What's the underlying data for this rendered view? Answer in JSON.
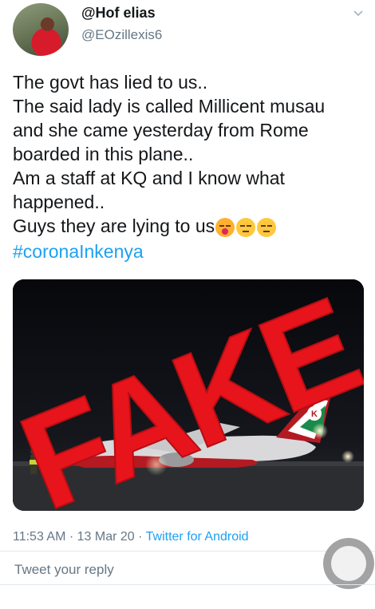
{
  "header": {
    "display_name": "@Hof elias",
    "handle": "@EOzillexis6"
  },
  "tweet": {
    "lines": [
      "The govt has lied to us..",
      "The said lady is called Millicent musau",
      "and she came yesterday from Rome",
      "boarded in this plane..",
      "Am a staff at KQ and I know what",
      "happened..",
      "Guys they are lying to us"
    ],
    "emojis": [
      "crying-face-icon",
      "unamused-face-icon",
      "unamused-face-icon"
    ],
    "hashtag": "#coronaInkenya"
  },
  "media": {
    "overlay_text": "FAKE",
    "overlay_color": "#e8141b",
    "tail_logo": "K"
  },
  "meta": {
    "time": "11:53 AM",
    "separator": " · ",
    "date": "13 Mar 20",
    "source": "Twitter for Android"
  },
  "reply": {
    "placeholder": "Tweet your reply"
  },
  "colors": {
    "link": "#1da1f2",
    "secondary_text": "#657786",
    "primary_text": "#14171a"
  }
}
